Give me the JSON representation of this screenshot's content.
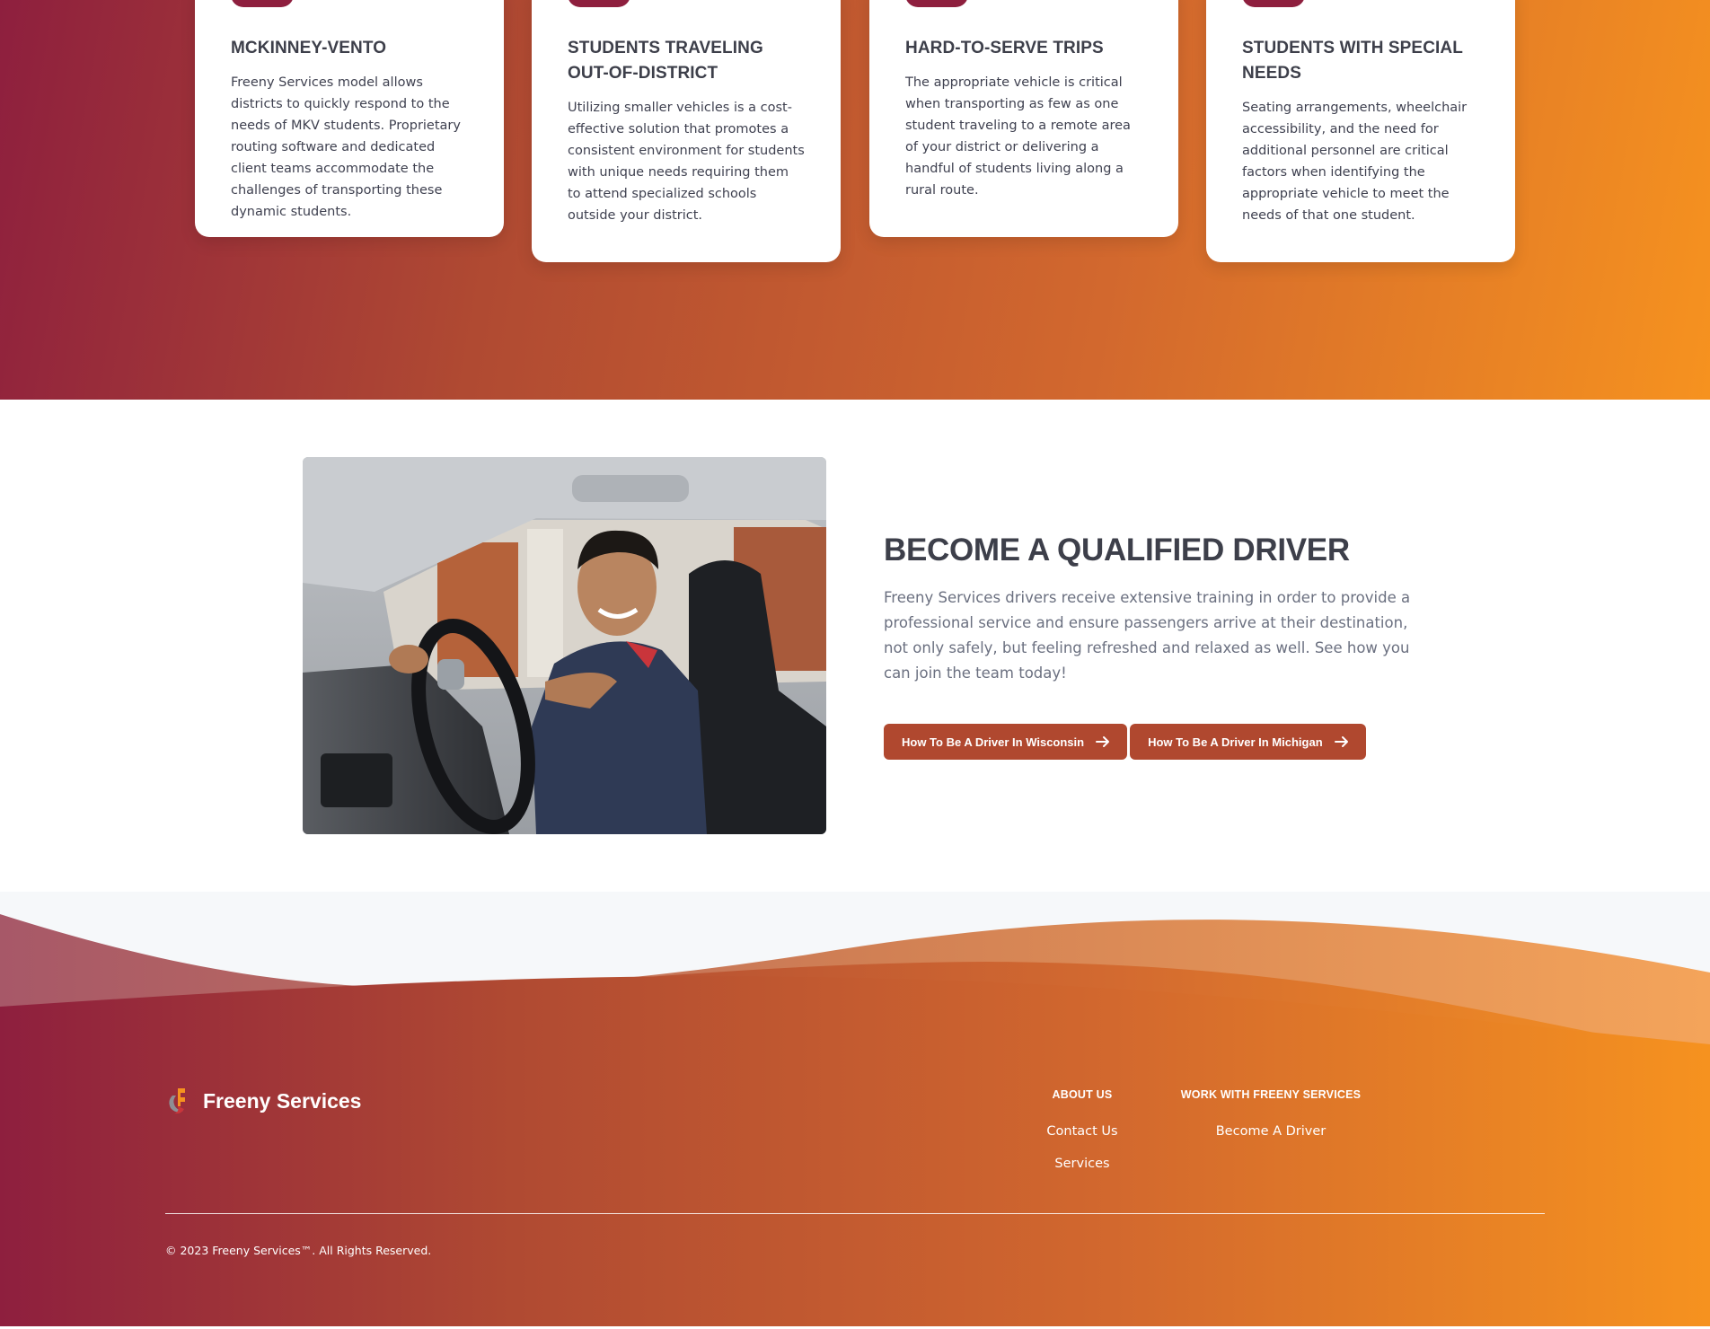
{
  "colors": {
    "gradient_start": "#8e1f3e",
    "gradient_end": "#f6921f",
    "button_bg": "#b0482f",
    "heading_text": "#3d3f4a",
    "body_text": "#6b7080"
  },
  "cards": [
    {
      "title": "MCKINNEY-VENTO",
      "body": "Freeny Services model allows districts to quickly respond to the needs of MKV students. Proprietary routing software and dedicated client teams accommodate the challenges of transporting these dynamic students."
    },
    {
      "title": "STUDENTS TRAVELING OUT-OF-DISTRICT",
      "body": "Utilizing smaller vehicles is a cost-effective solution that promotes a consistent environment for students with unique needs requiring them to attend specialized schools outside your district."
    },
    {
      "title": "HARD-TO-SERVE TRIPS",
      "body": "The appropriate vehicle is critical when transporting as few as one student traveling to a remote area of your district or delivering a handful of students living along a rural route."
    },
    {
      "title": "STUDENTS WITH SPECIAL NEEDS",
      "body": "Seating arrangements, wheelchair accessibility, and the need for additional personnel are critical factors when identifying the appropriate vehicle to meet the needs of that one student."
    }
  ],
  "driver": {
    "title": "BECOME A QUALIFIED DRIVER",
    "body": "Freeny Services drivers receive extensive training in order to provide a professional service and ensure passengers arrive at their destination, not only safely, but feeling refreshed and relaxed as well. See how you can join the team today!",
    "buttons": [
      {
        "label": "How To Be A Driver In Wisconsin",
        "icon": "arrow-right-icon"
      },
      {
        "label": "How To Be A Driver In Michigan",
        "icon": "arrow-right-icon"
      }
    ]
  },
  "footer": {
    "brand": "Freeny Services",
    "columns": [
      {
        "heading": "ABOUT US",
        "links": [
          "Contact Us",
          "Services"
        ]
      },
      {
        "heading": "WORK WITH FREENY SERVICES",
        "links": [
          "Become A Driver"
        ]
      }
    ],
    "copyright": "© 2023 Freeny Services™. All Rights Reserved."
  }
}
